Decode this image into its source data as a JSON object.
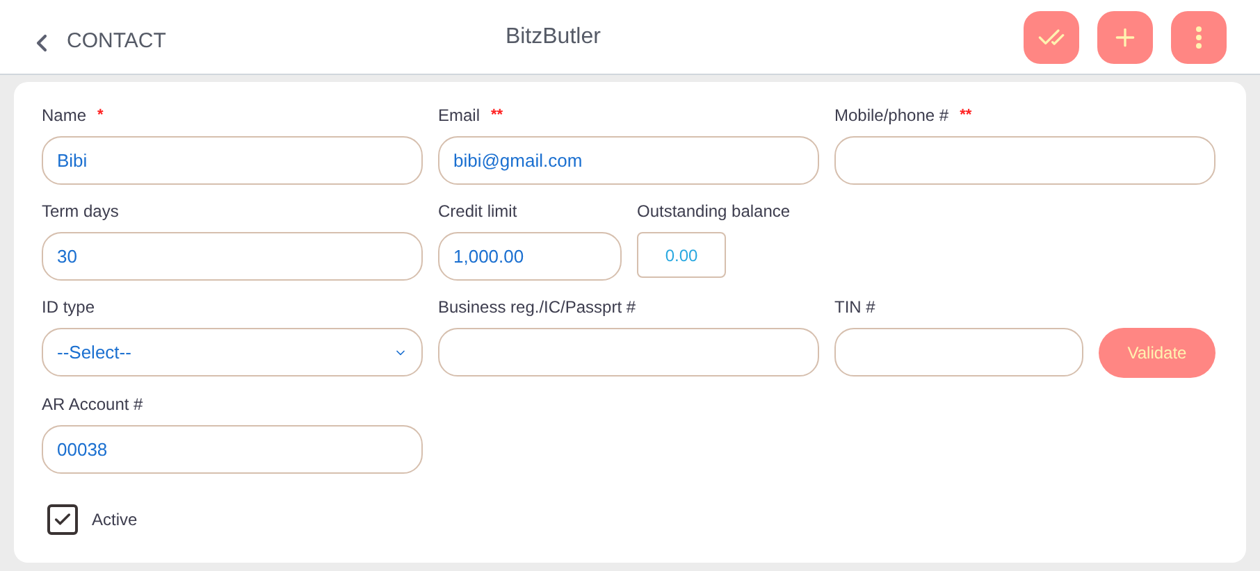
{
  "header": {
    "back_label": "CONTACT",
    "title": "BitzButler"
  },
  "rows": [
    [
      [
        {
          "kind": "text",
          "label": "Name",
          "required": "*",
          "value": "Bibi"
        }
      ],
      [
        {
          "kind": "text",
          "label": "Email",
          "required": "**",
          "value": "bibi@gmail.com"
        }
      ],
      [
        {
          "kind": "text",
          "label": "Mobile/phone #",
          "required": "**"
        }
      ]
    ],
    [
      [
        {
          "kind": "text",
          "label": "Term days",
          "value": "30"
        }
      ],
      [
        {
          "kind": "amount",
          "label": "Credit limit",
          "value": "1,000.00"
        },
        {
          "kind": "readonly",
          "label": "Outstanding balance",
          "value": "0.00"
        }
      ],
      []
    ],
    [
      [
        {
          "kind": "select",
          "label": "ID type",
          "value": "--Select--"
        }
      ],
      [
        {
          "kind": "text",
          "label": "Business reg./IC/Passprt #"
        }
      ],
      [
        {
          "kind": "text",
          "label": "TIN #"
        },
        {
          "kind": "button",
          "label": "Validate"
        }
      ]
    ],
    [
      [
        {
          "kind": "text",
          "label": "AR Account #",
          "value": "00038"
        }
      ],
      [],
      []
    ]
  ],
  "active": {
    "label": "Active",
    "checked": true
  }
}
